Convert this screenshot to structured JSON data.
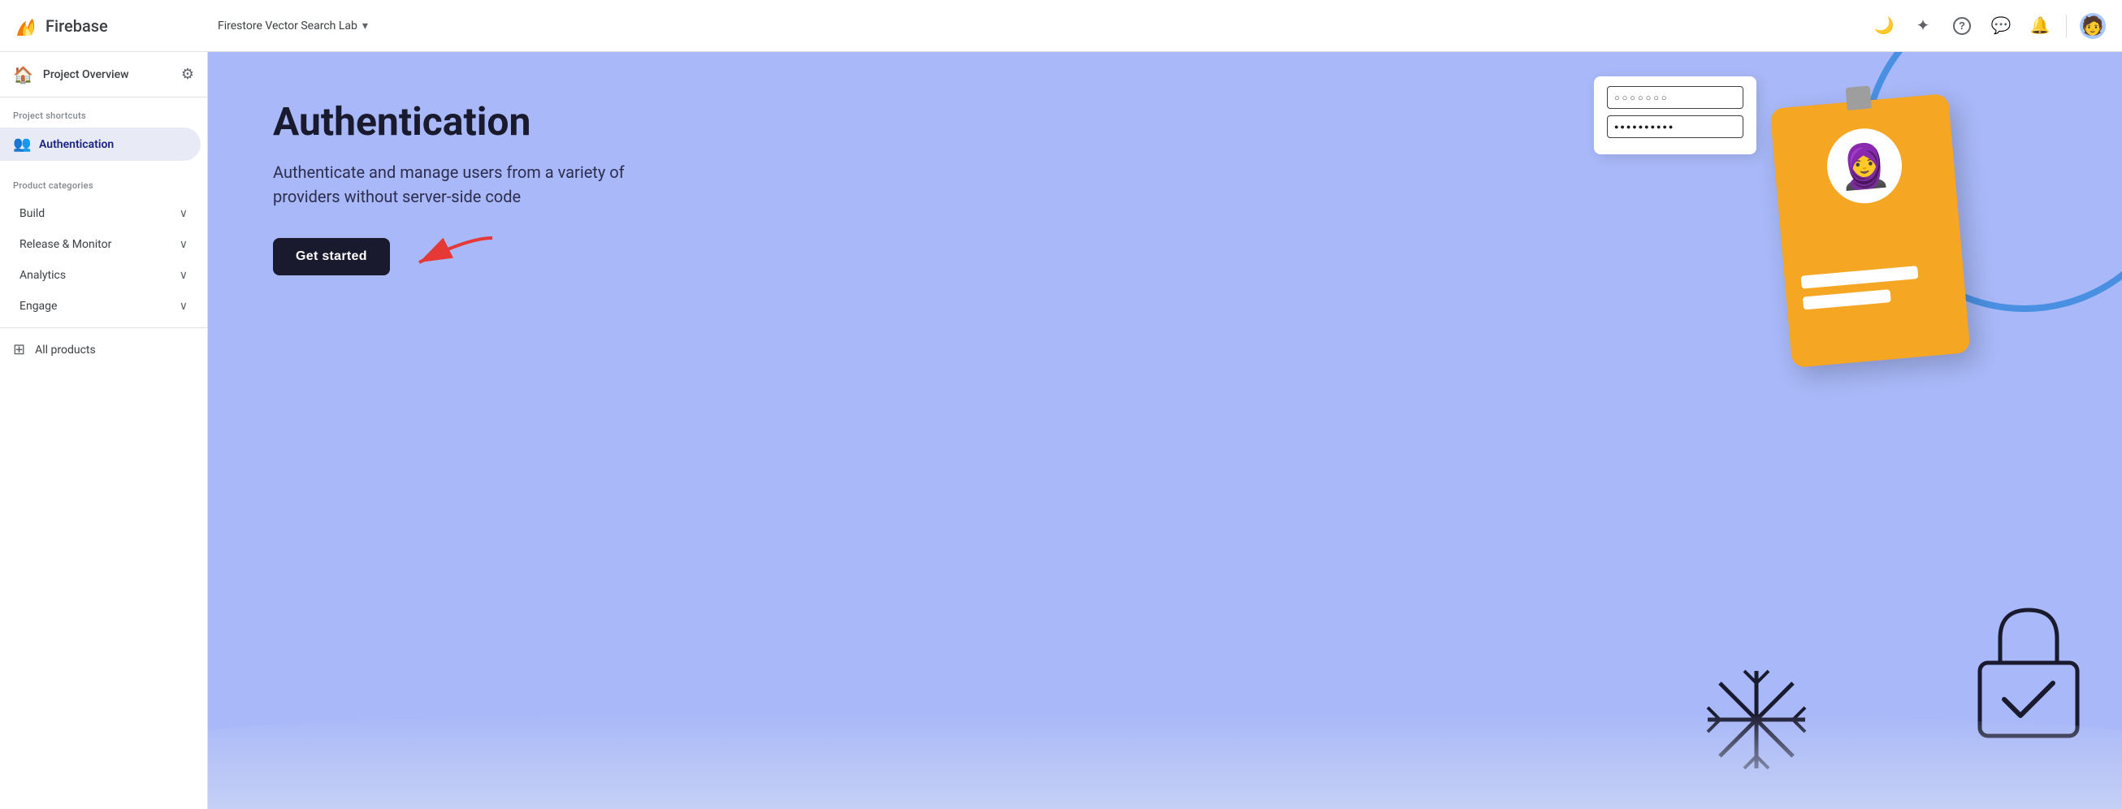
{
  "topbar": {
    "logo_text": "Firebase",
    "project_name": "Firestore Vector Search Lab",
    "dropdown_icon": "▾",
    "icons": {
      "dark_mode": "🌙",
      "sparkle": "✦",
      "help": "?",
      "chat": "💬",
      "notifications": "🔔"
    }
  },
  "sidebar": {
    "project_overview_label": "Project Overview",
    "project_shortcuts_label": "Project shortcuts",
    "authentication_label": "Authentication",
    "product_categories_label": "Product categories",
    "build_label": "Build",
    "release_monitor_label": "Release & Monitor",
    "analytics_label": "Analytics",
    "engage_label": "Engage",
    "all_products_label": "All products"
  },
  "main": {
    "hero_title": "Authentication",
    "hero_desc": "Authenticate and manage users from a variety of providers without server-side code",
    "get_started_label": "Get started"
  },
  "password_form": {
    "field1_dots": "○○○○○○○",
    "field2_dots": "●●●●●●●●●●"
  }
}
